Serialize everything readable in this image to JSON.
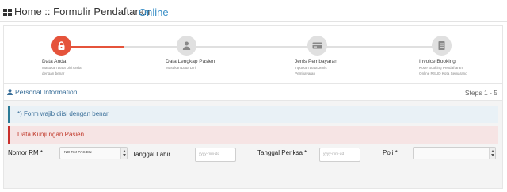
{
  "header": {
    "icon": "grid-icon",
    "title": "Home :: Formulir Pendaftaran",
    "subtitle": "Online",
    "subtitle_color": "#3a8fc7"
  },
  "wizard": {
    "accent_color": "#e5533b",
    "steps": [
      {
        "label": "Data Anda",
        "desc": "Masukan Data Diri Anda dengan benar",
        "icon": "lock-icon",
        "active": true
      },
      {
        "label": "Data Lengkap Pasien",
        "desc": "Masukan Data Diri",
        "icon": "user-icon",
        "active": false
      },
      {
        "label": "Jenis Pembayaran",
        "desc": "Inputkan Data Jenis Pembayaran",
        "icon": "credit-card-icon",
        "active": false
      },
      {
        "label": "Invoice Booking",
        "desc": "Kode Booking Pendaftaran Online RSUD Kota Semarang",
        "icon": "document-icon",
        "active": false
      }
    ]
  },
  "section": {
    "title": "Personal Information",
    "title_icon": "user-icon",
    "steps_label": "Steps 1 - 5"
  },
  "alerts": {
    "info": "*) Form wajib diisi dengan benar",
    "danger": "Data Kunjungan Pasien"
  },
  "form": {
    "nomor_rm": {
      "label": "Nomor RM *",
      "value": "NO RM PASIEN"
    },
    "tanggal_lahir": {
      "label": "Tanggal Lahir",
      "placeholder": "yyyy-mm-dd"
    },
    "tanggal_periksa": {
      "label": "Tanggal Periksa *",
      "placeholder": "yyyy-mm-dd"
    },
    "poli": {
      "label": "Poli *",
      "value": "-"
    }
  }
}
